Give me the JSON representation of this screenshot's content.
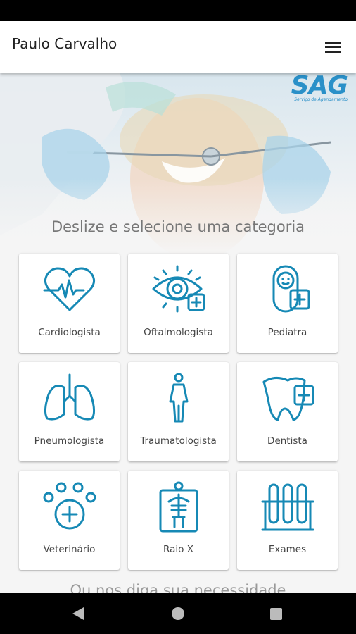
{
  "app_bar": {
    "title": "Paulo Carvalho"
  },
  "hero": {
    "logo_text": "SAG",
    "logo_subtitle": "Serviço de Agendamento"
  },
  "headline": "Deslize e selecione uma categoria",
  "categories": [
    {
      "label": "Cardiologista",
      "icon": "heart-pulse-icon"
    },
    {
      "label": "Oftalmologista",
      "icon": "eye-plus-icon"
    },
    {
      "label": "Pediatra",
      "icon": "baby-plus-icon"
    },
    {
      "label": "Pneumologista",
      "icon": "lungs-icon"
    },
    {
      "label": "Traumatologista",
      "icon": "person-icon"
    },
    {
      "label": "Dentista",
      "icon": "tooth-plus-icon"
    },
    {
      "label": "Veterinário",
      "icon": "paw-plus-icon"
    },
    {
      "label": "Raio X",
      "icon": "xray-icon"
    },
    {
      "label": "Exames",
      "icon": "test-tubes-icon"
    }
  ],
  "bottom_hint": "Ou nos diga sua necessidade",
  "colors": {
    "icon_accent": "#1689b5",
    "logo": "#2a90c8"
  }
}
